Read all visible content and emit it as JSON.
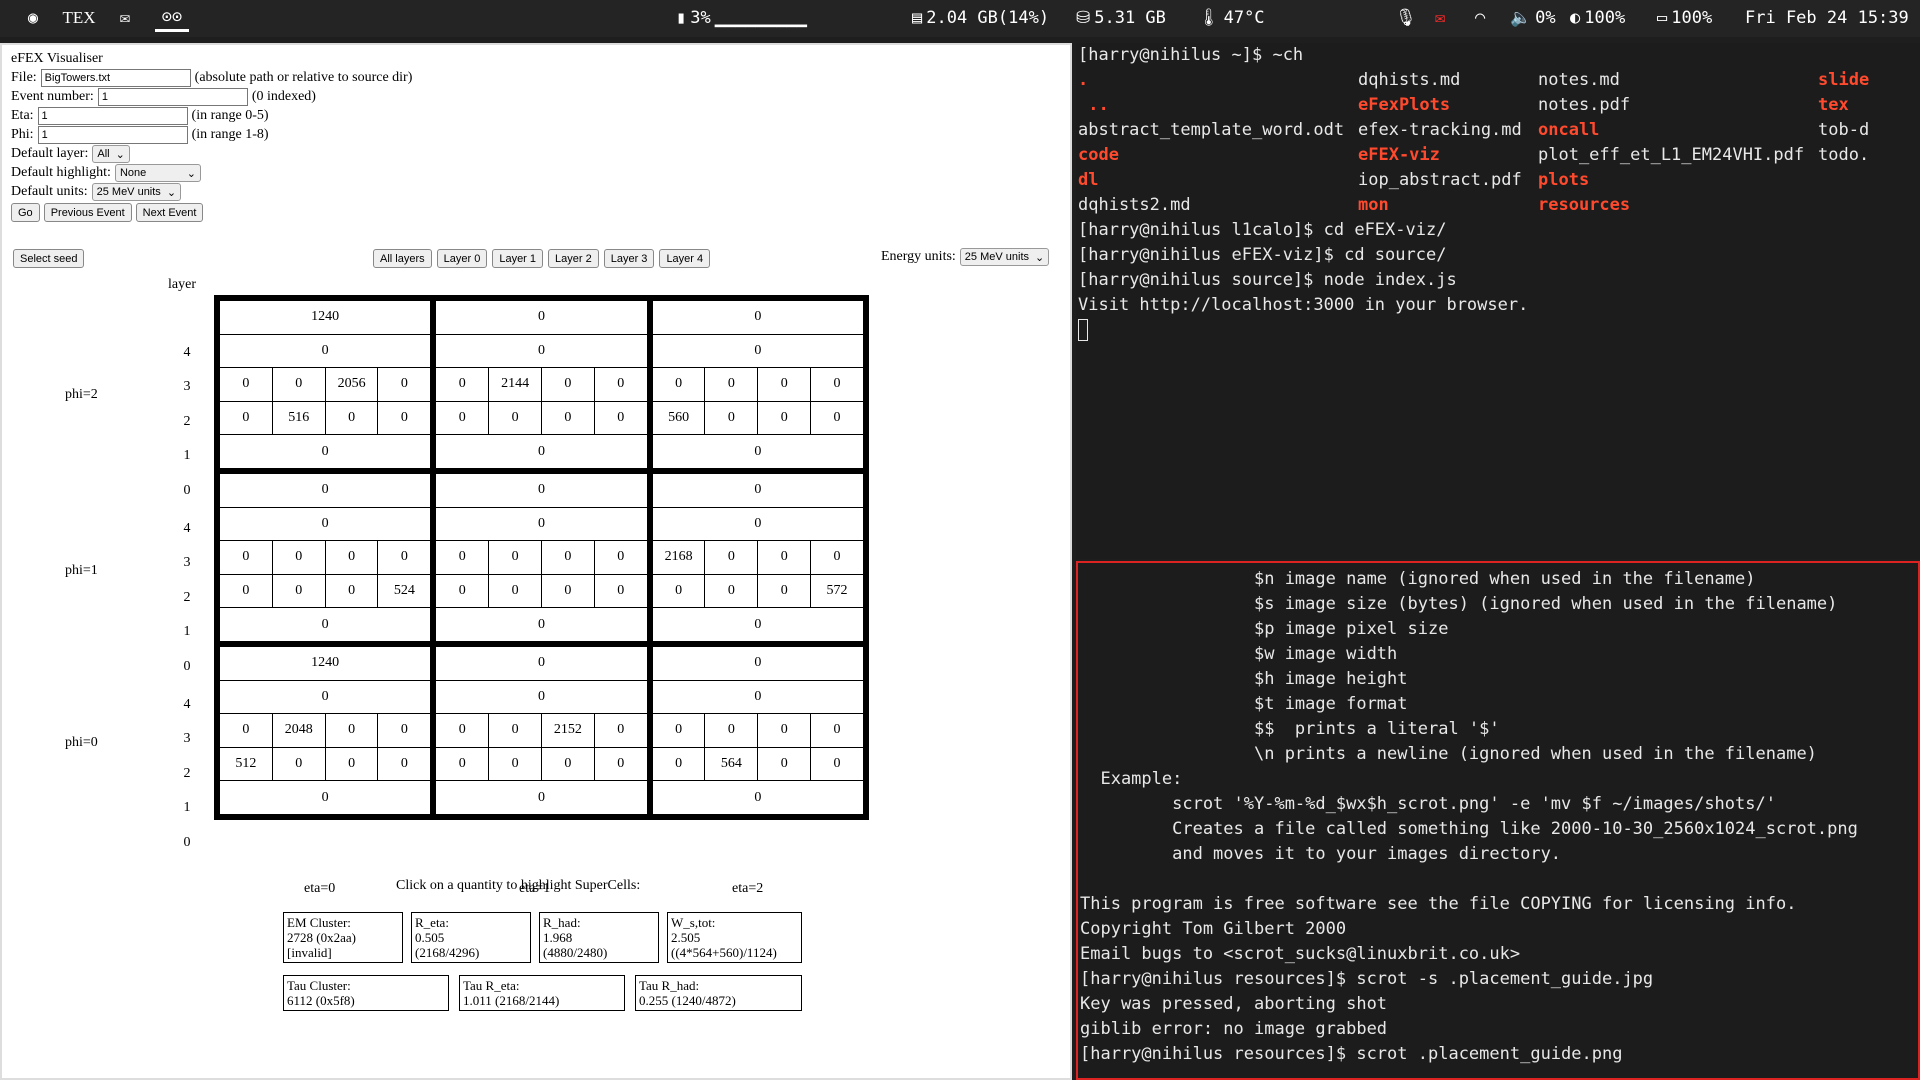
{
  "topbar": {
    "workspace_2": "TEX",
    "cpu": "3%",
    "cpu_bar": "▁▁▁▁▁▁▁▁▁",
    "mem": "2.04 GB(14%)",
    "disk": "5.31 GB",
    "temp": "47°C",
    "volume": "0%",
    "brightness": "100%",
    "battery": "100%",
    "datetime": "Fri Feb 24  15:39"
  },
  "app": {
    "title": "eFEX Visualiser",
    "file_label": "File:",
    "file_value": "BigTowers.txt",
    "file_hint": "(absolute path or relative to source dir)",
    "event_label": "Event number:",
    "event_value": "1",
    "event_hint": "(0 indexed)",
    "eta_label": "Eta:",
    "eta_value": "1",
    "eta_hint": "(in range 0-5)",
    "phi_label": "Phi:",
    "phi_value": "1",
    "phi_hint": "(in range 1-8)",
    "layer_label": "Default layer:",
    "layer_value": "All",
    "highlight_label": "Default highlight:",
    "highlight_value": "None",
    "units_label": "Default units:",
    "units_value": "25 MeV units",
    "go": "Go",
    "prev": "Previous Event",
    "next": "Next Event",
    "select_seed": "Select seed",
    "layer_buttons": [
      "All layers",
      "Layer 0",
      "Layer 1",
      "Layer 2",
      "Layer 3",
      "Layer 4"
    ],
    "energy_units_label": "Energy units:",
    "energy_units_value": "25 MeV units",
    "layer_header": "layer",
    "layer_numbers": [
      "4",
      "3",
      "2",
      "1",
      "0"
    ],
    "phi_labels": [
      "phi=2",
      "phi=1",
      "phi=0"
    ],
    "eta_labels": [
      "eta=0",
      "eta=1",
      "eta=2"
    ],
    "click_hint": "Click on a quantity to highlight SuperCells:",
    "grid": [
      [
        {
          "l4": "1240",
          "l3": "0",
          "l2": [
            "0",
            "0",
            "2056",
            "0"
          ],
          "l1": [
            "0",
            "516",
            "0",
            "0"
          ],
          "l0": "0"
        },
        {
          "l4": "0",
          "l3": "0",
          "l2": [
            "0",
            "2144",
            "0",
            "0"
          ],
          "l1": [
            "0",
            "0",
            "0",
            "0"
          ],
          "l0": "0"
        },
        {
          "l4": "0",
          "l3": "0",
          "l2": [
            "0",
            "0",
            "0",
            "0"
          ],
          "l1": [
            "560",
            "0",
            "0",
            "0"
          ],
          "l0": "0"
        }
      ],
      [
        {
          "l4": "0",
          "l3": "0",
          "l2": [
            "0",
            "0",
            "0",
            "0"
          ],
          "l1": [
            "0",
            "0",
            "0",
            "524"
          ],
          "l0": "0"
        },
        {
          "l4": "0",
          "l3": "0",
          "l2": [
            "0",
            "0",
            "0",
            "0"
          ],
          "l1": [
            "0",
            "0",
            "0",
            "0"
          ],
          "l0": "0"
        },
        {
          "l4": "0",
          "l3": "0",
          "l2": [
            "2168",
            "0",
            "0",
            "0"
          ],
          "l1": [
            "0",
            "0",
            "0",
            "572"
          ],
          "l0": "0"
        }
      ],
      [
        {
          "l4": "1240",
          "l3": "0",
          "l2": [
            "0",
            "2048",
            "0",
            "0"
          ],
          "l1": [
            "512",
            "0",
            "0",
            "0"
          ],
          "l0": "0"
        },
        {
          "l4": "0",
          "l3": "0",
          "l2": [
            "0",
            "0",
            "2152",
            "0"
          ],
          "l1": [
            "0",
            "0",
            "0",
            "0"
          ],
          "l0": "0"
        },
        {
          "l4": "0",
          "l3": "0",
          "l2": [
            "0",
            "0",
            "0",
            "0"
          ],
          "l1": [
            "0",
            "564",
            "0",
            "0"
          ],
          "l0": "0"
        }
      ]
    ],
    "quantities": [
      {
        "label": "EM Cluster:",
        "v1": "2728 (0x2aa)",
        "v2": "[invalid]"
      },
      {
        "label": "R_eta:",
        "v1": "0.505",
        "v2": "(2168/4296)"
      },
      {
        "label": "R_had:",
        "v1": "1.968",
        "v2": "(4880/2480)"
      },
      {
        "label": "W_s,tot:",
        "v1": "2.505",
        "v2": "((4*564+560)/1124)"
      },
      {
        "label": "Tau Cluster:",
        "v1": "6112 (0x5f8)"
      },
      {
        "label": "Tau R_eta:",
        "v1": "1.011 (2168/2144)"
      },
      {
        "label": "Tau R_had:",
        "v1": "0.255 (1240/4872)"
      }
    ]
  },
  "term_top": {
    "lines_before": [
      "[harry@nihilus ~]$ ~ch"
    ],
    "ls": [
      [
        ".",
        " ..",
        "abstract_template_word.odt",
        "code",
        "dl",
        "dqhists2.md"
      ],
      [
        "dqhists.md",
        "eFexPlots",
        "efex-tracking.md",
        "eFEX-viz",
        "iop_abstract.pdf",
        "mon"
      ],
      [
        "notes.md",
        "notes.pdf",
        "oncall",
        "plot_eff_et_L1_EM24VHI.pdf",
        "plots",
        "resources"
      ],
      [
        "slide",
        "tex",
        "tob-d",
        "todo."
      ]
    ],
    "ls_dirs": [
      [
        ".",
        "..",
        "code",
        "dl"
      ],
      [
        "eFexPlots",
        "eFEX-viz",
        "mon"
      ],
      [
        "oncall",
        "plots",
        "resources"
      ],
      [
        "slide",
        "tex"
      ]
    ],
    "lines_after": [
      "[harry@nihilus l1calo]$ cd eFEX-viz/",
      "[harry@nihilus eFEX-viz]$ cd source/",
      "[harry@nihilus source]$ node index.js",
      "Visit http://localhost:3000 in your browser."
    ]
  },
  "term_bottom": {
    "lines": [
      "                 $n image name (ignored when used in the filename)",
      "                 $s image size (bytes) (ignored when used in the filename)",
      "                 $p image pixel size",
      "                 $w image width",
      "                 $h image height",
      "                 $t image format",
      "                 $$  prints a literal '$'",
      "                 \\n prints a newline (ignored when used in the filename)",
      "  Example:",
      "         scrot '%Y-%m-%d_$wx$h_scrot.png' -e 'mv $f ~/images/shots/'",
      "         Creates a file called something like 2000-10-30_2560x1024_scrot.png",
      "         and moves it to your images directory.",
      "",
      "This program is free software see the file COPYING for licensing info.",
      "Copyright Tom Gilbert 2000",
      "Email bugs to <scrot_sucks@linuxbrit.co.uk>",
      "[harry@nihilus resources]$ scrot -s .placement_guide.jpg",
      "Key was pressed, aborting shot",
      "giblib error: no image grabbed",
      "[harry@nihilus resources]$ scrot .placement_guide.png"
    ]
  }
}
